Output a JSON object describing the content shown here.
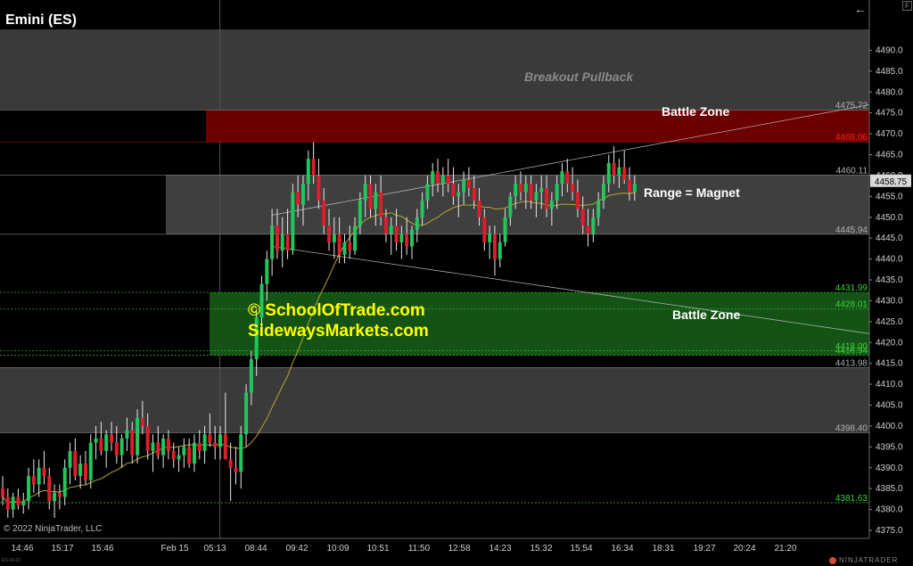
{
  "app": {
    "instrument_title": "Emini (ES)",
    "brand": "NINJATRADER",
    "copyright": "© 2022 NinjaTrader, LLC",
    "small_id": "ES 03-22",
    "panel_badge": "F"
  },
  "annotations": {
    "pattern_label": "Breakout Pullback",
    "battle_zone_upper_label": "Battle Zone",
    "range_label": "Range = Magnet",
    "battle_zone_lower_label": "Battle Zone",
    "watermark_line1": "© SchoolOfTrade.com",
    "watermark_line2": "SidewaysMarkets.com"
  },
  "colors": {
    "bull": "#22c55e",
    "bear": "#e01e2b",
    "wick": "#e8e8e8",
    "range_band": "#4a4a4a",
    "upper_zone": "#6b0000",
    "lower_zone": "#155215",
    "sma": "#b9a431",
    "price_marker": "#d9d9d9"
  },
  "chart_data": {
    "type": "candlestick",
    "y_axis": {
      "min": 4375,
      "max": 4495,
      "step": 5
    },
    "x_ticks": [
      "14:46",
      "15:17",
      "15:46",
      "Feb 15",
      "05:13",
      "08:44",
      "09:42",
      "10:09",
      "10:51",
      "11:50",
      "12:58",
      "14:23",
      "15:32",
      "15:54",
      "16:34",
      "18:31",
      "19:27",
      "20:24",
      "21:20"
    ],
    "current_price": "4458.75",
    "price_levels": [
      {
        "value": 4475.72,
        "label": "4475.72",
        "color": "#b0b0b0"
      },
      {
        "value": 4468.06,
        "label": "4468.06",
        "color": "#ff2020"
      },
      {
        "value": 4460.11,
        "label": "4460.11",
        "color": "#b0b0b0"
      },
      {
        "value": 4445.94,
        "label": "4445.94",
        "color": "#b0b0b0"
      },
      {
        "value": 4431.99,
        "label": "4431.99",
        "color": "#3cd23c"
      },
      {
        "value": 4428.01,
        "label": "4428.01",
        "color": "#3cd23c"
      },
      {
        "value": 4418.0,
        "label": "4418.00",
        "color": "#3cd23c"
      },
      {
        "value": 4416.94,
        "label": "4416.94",
        "color": "#3cd23c"
      },
      {
        "value": 4413.98,
        "label": "4413.98",
        "color": "#b0b0b0"
      },
      {
        "value": 4398.4,
        "label": "4398.40",
        "color": "#b0b0b0"
      },
      {
        "value": 4381.63,
        "label": "4381.63",
        "color": "#3cd23c"
      }
    ],
    "zones": {
      "upper_battle_zone": [
        4468.06,
        4475.72
      ],
      "range": [
        4445.94,
        4460.11
      ],
      "lower_battle_zone": [
        4416.94,
        4431.99
      ]
    },
    "shaded_bands": [
      [
        4475.72,
        4495
      ],
      [
        4398.4,
        4413.98
      ]
    ],
    "trendlines": [
      {
        "from": {
          "bar": 52,
          "price": 4450.5
        },
        "to": {
          "bar": 147,
          "price": 4472.3
        }
      },
      {
        "from": {
          "bar": 52,
          "price": 4443.0
        },
        "to": {
          "bar": 147,
          "price": 4425.8
        }
      }
    ],
    "session_break_bar": 44,
    "candles": [
      [
        4385,
        4388,
        4381,
        4383
      ],
      [
        4383,
        4385,
        4378,
        4380
      ],
      [
        4380,
        4384,
        4378,
        4383
      ],
      [
        4383,
        4385,
        4380,
        4381
      ],
      [
        4381,
        4384,
        4379,
        4382
      ],
      [
        4382,
        4390,
        4380,
        4388
      ],
      [
        4388,
        4392,
        4384,
        4386
      ],
      [
        4386,
        4392,
        4383,
        4390
      ],
      [
        4390,
        4394,
        4386,
        4388
      ],
      [
        4388,
        4390,
        4380,
        4382
      ],
      [
        4382,
        4386,
        4378,
        4384
      ],
      [
        4384,
        4386,
        4380,
        4383
      ],
      [
        4383,
        4392,
        4381,
        4390
      ],
      [
        4390,
        4396,
        4386,
        4394
      ],
      [
        4394,
        4397,
        4387,
        4388
      ],
      [
        4388,
        4393,
        4385,
        4391
      ],
      [
        4391,
        4394,
        4386,
        4387
      ],
      [
        4387,
        4398,
        4385,
        4396
      ],
      [
        4396,
        4400,
        4392,
        4397
      ],
      [
        4397,
        4401,
        4393,
        4394
      ],
      [
        4394,
        4399,
        4390,
        4398
      ],
      [
        4398,
        4401,
        4394,
        4396
      ],
      [
        4396,
        4400,
        4391,
        4393
      ],
      [
        4393,
        4398,
        4390,
        4397
      ],
      [
        4397,
        4402,
        4394,
        4399
      ],
      [
        4399,
        4401,
        4391,
        4393
      ],
      [
        4393,
        4404,
        4391,
        4402
      ],
      [
        4402,
        4406,
        4398,
        4400
      ],
      [
        4400,
        4403,
        4392,
        4394
      ],
      [
        4394,
        4398,
        4389,
        4396
      ],
      [
        4396,
        4400,
        4392,
        4393
      ],
      [
        4393,
        4398,
        4390,
        4397
      ],
      [
        4397,
        4399,
        4392,
        4394
      ],
      [
        4394,
        4396,
        4390,
        4392
      ],
      [
        4392,
        4395,
        4389,
        4393
      ],
      [
        4393,
        4397,
        4390,
        4395
      ],
      [
        4395,
        4397,
        4390,
        4391
      ],
      [
        4391,
        4398,
        4389,
        4396
      ],
      [
        4396,
        4399,
        4392,
        4394
      ],
      [
        4394,
        4400,
        4391,
        4398
      ],
      [
        4398,
        4403,
        4395,
        4396
      ],
      [
        4396,
        4400,
        4392,
        4395
      ],
      [
        4395,
        4400,
        4392,
        4398
      ],
      [
        4398,
        4408,
        4394,
        4392
      ],
      [
        4392,
        4396,
        4382,
        4390
      ],
      [
        4390,
        4395,
        4386,
        4389
      ],
      [
        4389,
        4400,
        4385,
        4398
      ],
      [
        4398,
        4410,
        4395,
        4408
      ],
      [
        4408,
        4418,
        4405,
        4416
      ],
      [
        4416,
        4428,
        4412,
        4426
      ],
      [
        4426,
        4436,
        4422,
        4434
      ],
      [
        4434,
        4442,
        4430,
        4440
      ],
      [
        4440,
        4452,
        4436,
        4448
      ],
      [
        4448,
        4452,
        4440,
        4442
      ],
      [
        4442,
        4450,
        4438,
        4446
      ],
      [
        4446,
        4452,
        4440,
        4442
      ],
      [
        4442,
        4458,
        4441,
        4456
      ],
      [
        4456,
        4460,
        4450,
        4453
      ],
      [
        4453,
        4460,
        4448,
        4458
      ],
      [
        4458,
        4466,
        4454,
        4464
      ],
      [
        4464,
        4468,
        4458,
        4460
      ],
      [
        4460,
        4464,
        4452,
        4454
      ],
      [
        4454,
        4457,
        4446,
        4448
      ],
      [
        4448,
        4452,
        4442,
        4444
      ],
      [
        4444,
        4450,
        4440,
        4446
      ],
      [
        4446,
        4450,
        4439,
        4441
      ],
      [
        4441,
        4446,
        4439,
        4444
      ],
      [
        4444,
        4448,
        4440,
        4442
      ],
      [
        4442,
        4450,
        4441,
        4448
      ],
      [
        4448,
        4456,
        4446,
        4454
      ],
      [
        4454,
        4460,
        4450,
        4458
      ],
      [
        4458,
        4460,
        4450,
        4452
      ],
      [
        4452,
        4458,
        4448,
        4456
      ],
      [
        4456,
        4460,
        4448,
        4450
      ],
      [
        4450,
        4452,
        4444,
        4446
      ],
      [
        4446,
        4450,
        4441,
        4448
      ],
      [
        4448,
        4452,
        4442,
        4444
      ],
      [
        4444,
        4448,
        4440,
        4446
      ],
      [
        4446,
        4450,
        4441,
        4443
      ],
      [
        4443,
        4448,
        4440,
        4447
      ],
      [
        4447,
        4452,
        4444,
        4450
      ],
      [
        4450,
        4456,
        4448,
        4454
      ],
      [
        4454,
        4460,
        4452,
        4458
      ],
      [
        4458,
        4463,
        4455,
        4461
      ],
      [
        4461,
        4464,
        4456,
        4458
      ],
      [
        4458,
        4462,
        4455,
        4460
      ],
      [
        4460,
        4464,
        4456,
        4458
      ],
      [
        4458,
        4462,
        4453,
        4455
      ],
      [
        4455,
        4458,
        4450,
        4456
      ],
      [
        4456,
        4461,
        4453,
        4459
      ],
      [
        4459,
        4462,
        4455,
        4457
      ],
      [
        4457,
        4460,
        4452,
        4454
      ],
      [
        4454,
        4457,
        4448,
        4450
      ],
      [
        4450,
        4452,
        4442,
        4444
      ],
      [
        4444,
        4448,
        4440,
        4446
      ],
      [
        4446,
        4448,
        4436,
        4440
      ],
      [
        4440,
        4446,
        4438,
        4444
      ],
      [
        4444,
        4452,
        4443,
        4450
      ],
      [
        4450,
        4456,
        4448,
        4455
      ],
      [
        4455,
        4460,
        4452,
        4458
      ],
      [
        4458,
        4461,
        4454,
        4456
      ],
      [
        4456,
        4460,
        4452,
        4458
      ],
      [
        4458,
        4460,
        4452,
        4454
      ],
      [
        4454,
        4458,
        4450,
        4456
      ],
      [
        4456,
        4460,
        4452,
        4457
      ],
      [
        4457,
        4460,
        4450,
        4452
      ],
      [
        4452,
        4456,
        4448,
        4454
      ],
      [
        4454,
        4460,
        4452,
        4458
      ],
      [
        4458,
        4463,
        4455,
        4461
      ],
      [
        4461,
        4464,
        4456,
        4458
      ],
      [
        4458,
        4462,
        4454,
        4456
      ],
      [
        4456,
        4459,
        4450,
        4452
      ],
      [
        4452,
        4455,
        4446,
        4448
      ],
      [
        4448,
        4452,
        4443,
        4446
      ],
      [
        4446,
        4452,
        4444,
        4450
      ],
      [
        4450,
        4456,
        4448,
        4454
      ],
      [
        4454,
        4460,
        4452,
        4458
      ],
      [
        4458,
        4465,
        4456,
        4463
      ],
      [
        4463,
        4467,
        4458,
        4460
      ],
      [
        4460,
        4464,
        4457,
        4462
      ],
      [
        4462,
        4466,
        4458,
        4459
      ],
      [
        4459,
        4462,
        4454,
        4456
      ],
      [
        4456,
        4460,
        4454,
        4458
      ]
    ]
  }
}
